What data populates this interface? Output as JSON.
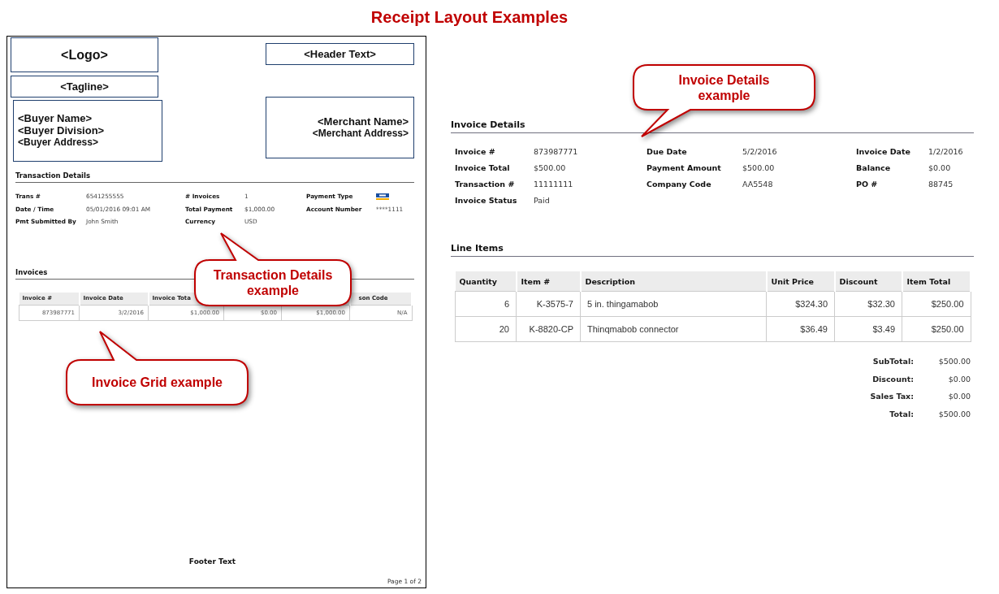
{
  "title": "Receipt Layout Examples",
  "receipt": {
    "logo": "<Logo>",
    "header_text": "<Header Text>",
    "tagline": "<Tagline>",
    "buyer": [
      "<Buyer Name>",
      "<Buyer Division>",
      "<Buyer Address>"
    ],
    "merchant": [
      "<Merchant Name>",
      "<Merchant Address>"
    ],
    "transaction": {
      "title": "Transaction Details",
      "rows": [
        [
          {
            "kind": "text",
            "label": "Trans #",
            "value": "6541255555"
          },
          {
            "kind": "text",
            "label": "# Invoices",
            "value": "1"
          },
          {
            "kind": "card",
            "label": "Payment Type"
          }
        ],
        [
          {
            "kind": "text",
            "label": "Date / Time",
            "value": "05/01/2016 09:01 AM"
          },
          {
            "kind": "text",
            "label": "Total Payment",
            "value": "$1,000.00"
          },
          {
            "kind": "text",
            "label": "Account Number",
            "value": "****1111"
          }
        ],
        [
          {
            "kind": "text",
            "label": "Pmt Submitted By",
            "value": "John Smith"
          },
          {
            "kind": "text",
            "label": "Currency",
            "value": "USD"
          }
        ]
      ]
    },
    "invoices": {
      "title": "Invoices",
      "columns": [
        {
          "label": "Invoice #"
        },
        {
          "label": "Invoice Date"
        },
        {
          "label": "Invoice Tota"
        },
        {},
        {},
        {
          "label": "son Code"
        }
      ],
      "rows": [
        [
          "873987771",
          "3/2/2016",
          "$1,000.00",
          "$0.00",
          "$1,000.00",
          "N/A"
        ]
      ]
    },
    "footer": "Footer Text",
    "page": "Page 1 of 2"
  },
  "invoice_details": {
    "title": "Invoice Details",
    "rows": [
      [
        {
          "label": "Invoice #",
          "value": "873987771"
        },
        {
          "label": "Due Date",
          "value": "5/2/2016"
        },
        {
          "label": "Invoice Date",
          "value": "1/2/2016"
        }
      ],
      [
        {
          "label": "Invoice Total",
          "value": "$500.00"
        },
        {
          "label": "Payment Amount",
          "value": "$500.00"
        },
        {
          "label": "Balance",
          "value": "$0.00"
        }
      ],
      [
        {
          "label": "Transaction #",
          "value": "11111111"
        },
        {
          "label": "Company Code",
          "value": "AA5548"
        },
        {
          "label": "PO #",
          "value": "88745"
        }
      ],
      [
        {
          "label": "Invoice Status",
          "value": "Paid"
        }
      ]
    ]
  },
  "line_items": {
    "title": "Line Items",
    "columns": [
      "Quantity",
      "Item #",
      "Description",
      "Unit Price",
      "Discount",
      "Item Total"
    ],
    "rows": [
      [
        "6",
        "K-3575-7",
        "5 in. thingamabob",
        "$324.30",
        "$32.30",
        "$250.00"
      ],
      [
        "20",
        "K-8820-CP",
        "Thinqmabob connector",
        "$36.49",
        "$3.49",
        "$250.00"
      ]
    ],
    "totals": [
      {
        "label": "SubTotal:",
        "value": "$500.00"
      },
      {
        "label": "Discount:",
        "value": "$0.00"
      },
      {
        "label": "Sales Tax:",
        "value": "$0.00"
      },
      {
        "label": "Total:",
        "value": "$500.00"
      }
    ]
  },
  "callouts": [
    {
      "text": "Invoice Details example"
    },
    {
      "text": "Transaction Details example"
    },
    {
      "text": "Invoice Grid example"
    }
  ]
}
